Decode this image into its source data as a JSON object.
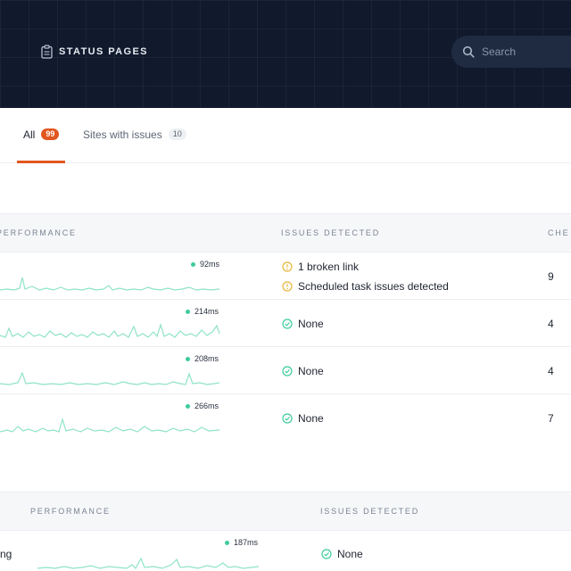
{
  "header": {
    "nav_label": "STATUS PAGES",
    "nav_icon": "clipboard-icon",
    "search_placeholder": "Search",
    "search_icon": "search-icon"
  },
  "tabs": [
    {
      "label": "All",
      "count": "99",
      "active": true
    },
    {
      "label": "Sites with issues",
      "count": "10",
      "active": false
    }
  ],
  "colors": {
    "header_bg": "#101a2c",
    "accent": "#e2561f",
    "sparkline": "#8fe3c6",
    "ok_green": "#3ecb9d",
    "warning": "#e7b53b"
  },
  "table1": {
    "columns": [
      "PERFORMANCE",
      "ISSUES DETECTED",
      "CHE"
    ],
    "rows": [
      {
        "response": "92ms",
        "issues": [
          {
            "text": "1 broken link",
            "status": "warning"
          },
          {
            "text": "Scheduled task issues detected",
            "status": "warning"
          }
        ],
        "count": "9"
      },
      {
        "response": "214ms",
        "issues": [
          {
            "text": "None",
            "status": "ok"
          }
        ],
        "count": "4"
      },
      {
        "response": "208ms",
        "issues": [
          {
            "text": "None",
            "status": "ok"
          }
        ],
        "count": "4"
      },
      {
        "response": "266ms",
        "issues": [
          {
            "text": "None",
            "status": "ok"
          }
        ],
        "count": "7"
      }
    ]
  },
  "table2": {
    "columns": [
      "PERFORMANCE",
      "ISSUES DETECTED"
    ],
    "rows": [
      {
        "site": "ng",
        "response": "187ms",
        "issues": [
          {
            "text": "None",
            "status": "ok"
          }
        ]
      }
    ]
  }
}
